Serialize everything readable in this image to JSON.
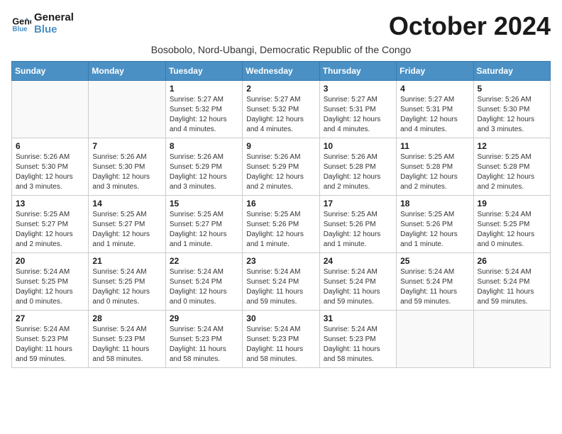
{
  "header": {
    "logo_line1": "General",
    "logo_line2": "Blue",
    "month_title": "October 2024",
    "subtitle": "Bosobolo, Nord-Ubangi, Democratic Republic of the Congo"
  },
  "weekdays": [
    "Sunday",
    "Monday",
    "Tuesday",
    "Wednesday",
    "Thursday",
    "Friday",
    "Saturday"
  ],
  "weeks": [
    [
      {
        "day": "",
        "detail": ""
      },
      {
        "day": "",
        "detail": ""
      },
      {
        "day": "1",
        "detail": "Sunrise: 5:27 AM\nSunset: 5:32 PM\nDaylight: 12 hours and 4 minutes."
      },
      {
        "day": "2",
        "detail": "Sunrise: 5:27 AM\nSunset: 5:32 PM\nDaylight: 12 hours and 4 minutes."
      },
      {
        "day": "3",
        "detail": "Sunrise: 5:27 AM\nSunset: 5:31 PM\nDaylight: 12 hours and 4 minutes."
      },
      {
        "day": "4",
        "detail": "Sunrise: 5:27 AM\nSunset: 5:31 PM\nDaylight: 12 hours and 4 minutes."
      },
      {
        "day": "5",
        "detail": "Sunrise: 5:26 AM\nSunset: 5:30 PM\nDaylight: 12 hours and 3 minutes."
      }
    ],
    [
      {
        "day": "6",
        "detail": "Sunrise: 5:26 AM\nSunset: 5:30 PM\nDaylight: 12 hours and 3 minutes."
      },
      {
        "day": "7",
        "detail": "Sunrise: 5:26 AM\nSunset: 5:30 PM\nDaylight: 12 hours and 3 minutes."
      },
      {
        "day": "8",
        "detail": "Sunrise: 5:26 AM\nSunset: 5:29 PM\nDaylight: 12 hours and 3 minutes."
      },
      {
        "day": "9",
        "detail": "Sunrise: 5:26 AM\nSunset: 5:29 PM\nDaylight: 12 hours and 2 minutes."
      },
      {
        "day": "10",
        "detail": "Sunrise: 5:26 AM\nSunset: 5:28 PM\nDaylight: 12 hours and 2 minutes."
      },
      {
        "day": "11",
        "detail": "Sunrise: 5:25 AM\nSunset: 5:28 PM\nDaylight: 12 hours and 2 minutes."
      },
      {
        "day": "12",
        "detail": "Sunrise: 5:25 AM\nSunset: 5:28 PM\nDaylight: 12 hours and 2 minutes."
      }
    ],
    [
      {
        "day": "13",
        "detail": "Sunrise: 5:25 AM\nSunset: 5:27 PM\nDaylight: 12 hours and 2 minutes."
      },
      {
        "day": "14",
        "detail": "Sunrise: 5:25 AM\nSunset: 5:27 PM\nDaylight: 12 hours and 1 minute."
      },
      {
        "day": "15",
        "detail": "Sunrise: 5:25 AM\nSunset: 5:27 PM\nDaylight: 12 hours and 1 minute."
      },
      {
        "day": "16",
        "detail": "Sunrise: 5:25 AM\nSunset: 5:26 PM\nDaylight: 12 hours and 1 minute."
      },
      {
        "day": "17",
        "detail": "Sunrise: 5:25 AM\nSunset: 5:26 PM\nDaylight: 12 hours and 1 minute."
      },
      {
        "day": "18",
        "detail": "Sunrise: 5:25 AM\nSunset: 5:26 PM\nDaylight: 12 hours and 1 minute."
      },
      {
        "day": "19",
        "detail": "Sunrise: 5:24 AM\nSunset: 5:25 PM\nDaylight: 12 hours and 0 minutes."
      }
    ],
    [
      {
        "day": "20",
        "detail": "Sunrise: 5:24 AM\nSunset: 5:25 PM\nDaylight: 12 hours and 0 minutes."
      },
      {
        "day": "21",
        "detail": "Sunrise: 5:24 AM\nSunset: 5:25 PM\nDaylight: 12 hours and 0 minutes."
      },
      {
        "day": "22",
        "detail": "Sunrise: 5:24 AM\nSunset: 5:24 PM\nDaylight: 12 hours and 0 minutes."
      },
      {
        "day": "23",
        "detail": "Sunrise: 5:24 AM\nSunset: 5:24 PM\nDaylight: 11 hours and 59 minutes."
      },
      {
        "day": "24",
        "detail": "Sunrise: 5:24 AM\nSunset: 5:24 PM\nDaylight: 11 hours and 59 minutes."
      },
      {
        "day": "25",
        "detail": "Sunrise: 5:24 AM\nSunset: 5:24 PM\nDaylight: 11 hours and 59 minutes."
      },
      {
        "day": "26",
        "detail": "Sunrise: 5:24 AM\nSunset: 5:24 PM\nDaylight: 11 hours and 59 minutes."
      }
    ],
    [
      {
        "day": "27",
        "detail": "Sunrise: 5:24 AM\nSunset: 5:23 PM\nDaylight: 11 hours and 59 minutes."
      },
      {
        "day": "28",
        "detail": "Sunrise: 5:24 AM\nSunset: 5:23 PM\nDaylight: 11 hours and 58 minutes."
      },
      {
        "day": "29",
        "detail": "Sunrise: 5:24 AM\nSunset: 5:23 PM\nDaylight: 11 hours and 58 minutes."
      },
      {
        "day": "30",
        "detail": "Sunrise: 5:24 AM\nSunset: 5:23 PM\nDaylight: 11 hours and 58 minutes."
      },
      {
        "day": "31",
        "detail": "Sunrise: 5:24 AM\nSunset: 5:23 PM\nDaylight: 11 hours and 58 minutes."
      },
      {
        "day": "",
        "detail": ""
      },
      {
        "day": "",
        "detail": ""
      }
    ]
  ]
}
